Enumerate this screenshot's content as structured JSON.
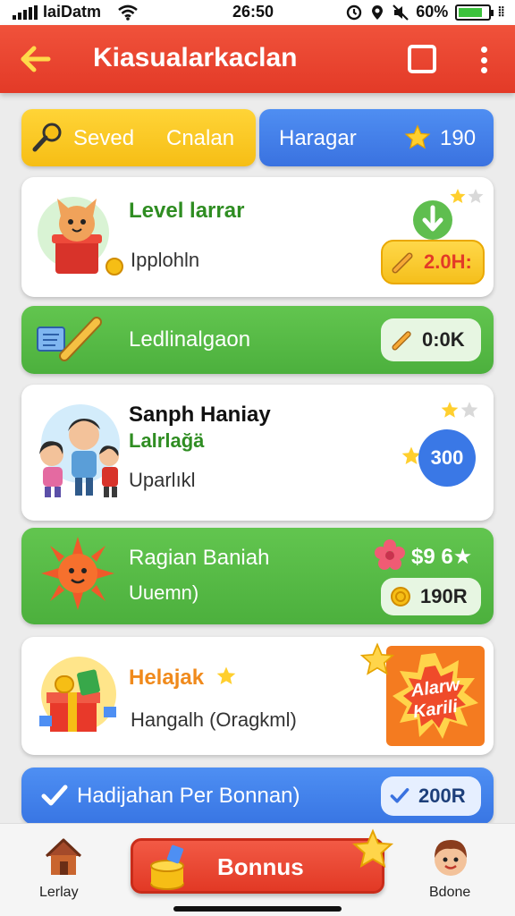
{
  "status_bar": {
    "carrier": "IaiDatm",
    "time": "26:50",
    "battery_percent": "60%",
    "battery_level": 0.8
  },
  "app_bar": {
    "title": "Kiasualarkaclan",
    "back_icon": "arrow-left-icon",
    "square_icon": "square-icon",
    "more_icon": "more-vertical-icon"
  },
  "filters": {
    "saved_label": "Seved",
    "chain_label": "Cnalan",
    "harvest_label": "Haragar",
    "star_count": "190"
  },
  "cards": [
    {
      "title": "Level larrar",
      "subtitle": "Ipplohln",
      "badge": "2.0H:",
      "stars": 1
    },
    {
      "title": "Ledlinalgaon",
      "badge": "0:0K"
    },
    {
      "title": "Sanph Haniay",
      "tag": "Lalrlağä",
      "subtitle": "Uparlıkl",
      "badge": "300",
      "stars": 1
    },
    {
      "title": "Ragian Baniah",
      "subtitle": "Uuemn)",
      "price": "$9 6★",
      "badge": "190R"
    },
    {
      "title": "Helajak",
      "subtitle": "Hangalh (Oragkml)",
      "promo_lines": [
        "Alarw",
        "Karili"
      ]
    },
    {
      "title": "Hadijahan Per Bonnan)",
      "badge": "200R"
    }
  ],
  "bottom_nav": {
    "left_label": "Lerlay",
    "bonus_label": "Bonnus",
    "right_label": "Bdone"
  },
  "colors": {
    "red": "#e53a27",
    "yellow": "#f6be15",
    "blue": "#3a72e0",
    "green": "#4cb03d",
    "orange": "#f47b20"
  }
}
